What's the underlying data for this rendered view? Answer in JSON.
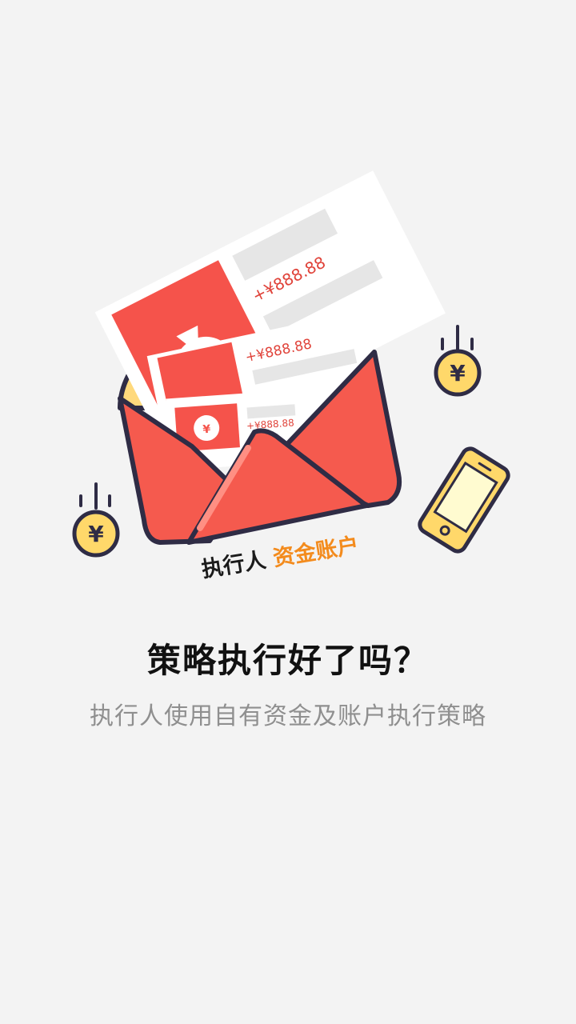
{
  "illustration": {
    "receipt_amount_1": "+¥888.88",
    "receipt_amount_2": "+¥888.88",
    "receipt_amount_3": "+¥888.88",
    "bag_symbol": "¥",
    "coin_symbol": "¥",
    "caption_prefix": "执行人",
    "caption_highlight": "资金账户",
    "caption_highlight_color": "#f38b1d",
    "accent_red": "#f55a4e",
    "coin_yellow": "#ffd86a"
  },
  "text": {
    "headline": "策略执行好了吗？",
    "subline": "执行人使用自有资金及账户执行策略"
  }
}
